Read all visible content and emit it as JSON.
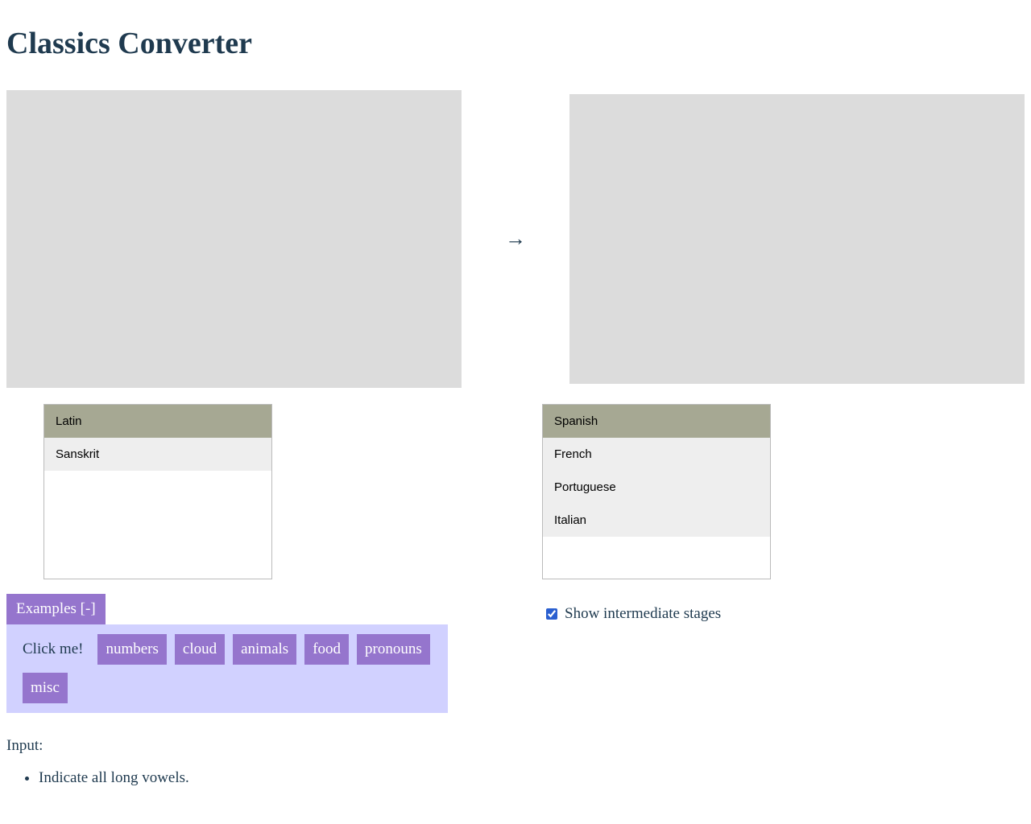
{
  "title": "Classics Converter",
  "arrow": "→",
  "source_languages": [
    "Latin",
    "Sanskrit"
  ],
  "source_selected": 0,
  "target_languages": [
    "Spanish",
    "French",
    "Portuguese",
    "Italian"
  ],
  "target_selected": 0,
  "examples_toggle": "Examples [-]",
  "click_me": "Click me!",
  "example_buttons": [
    "numbers",
    "cloud",
    "animals",
    "food",
    "pronouns",
    "misc"
  ],
  "show_intermediate_label": "Show intermediate stages",
  "show_intermediate_checked": true,
  "input_label": "Input:",
  "input_notes": [
    "Indicate all long vowels."
  ]
}
